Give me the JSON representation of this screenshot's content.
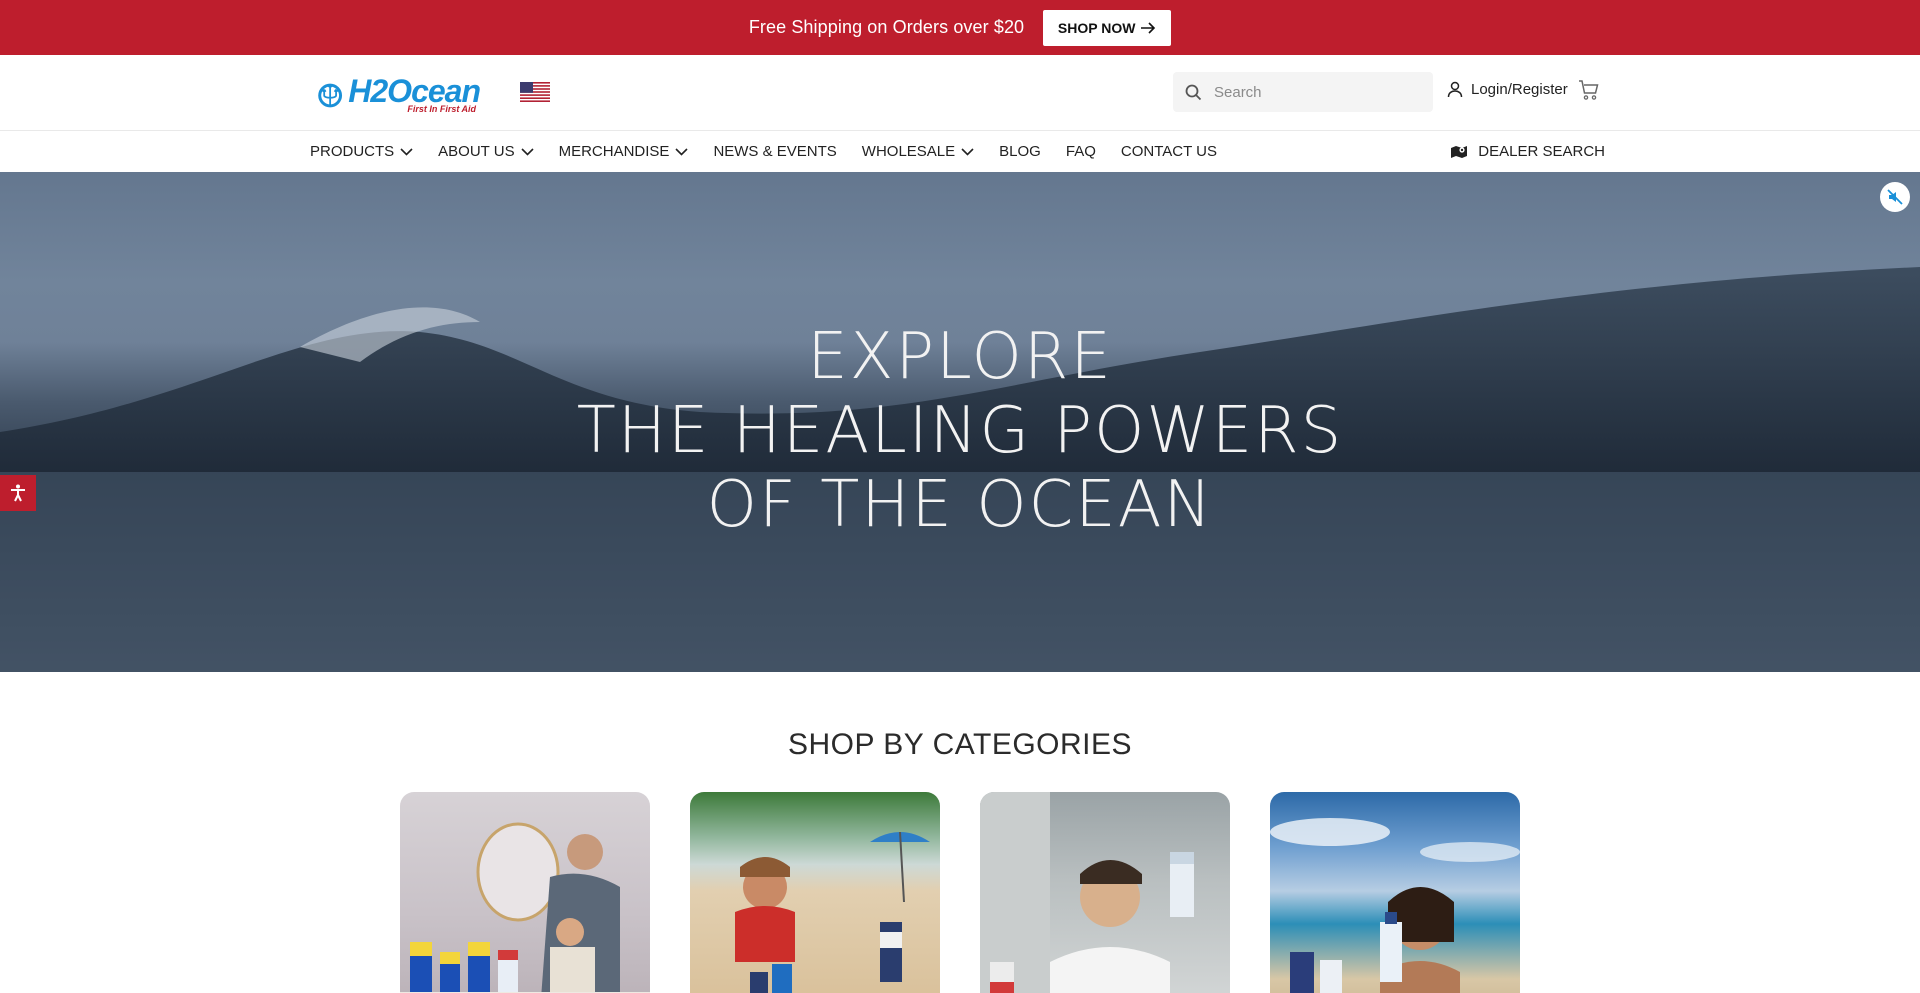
{
  "announcement": {
    "text": "Free Shipping on Orders over $20",
    "button_label": "SHOP NOW"
  },
  "header": {
    "logo_text": "H2Ocean",
    "logo_tagline": "First In First Aid",
    "search_placeholder": "Search",
    "login_label": "Login/Register"
  },
  "nav": {
    "items": [
      {
        "label": "PRODUCTS",
        "dropdown": true
      },
      {
        "label": "ABOUT US",
        "dropdown": true
      },
      {
        "label": "MERCHANDISE",
        "dropdown": true
      },
      {
        "label": "NEWS & EVENTS",
        "dropdown": false
      },
      {
        "label": "WHOLESALE",
        "dropdown": true
      },
      {
        "label": "BLOG",
        "dropdown": false
      },
      {
        "label": "FAQ",
        "dropdown": false
      },
      {
        "label": "CONTACT US",
        "dropdown": false
      }
    ],
    "dealer_label": "DEALER SEARCH"
  },
  "hero": {
    "line1": "EXPLORE",
    "line2": "THE HEALING POWERS",
    "line3": "OF THE OCEAN"
  },
  "categories": {
    "title": "SHOP BY CATEGORIES"
  },
  "colors": {
    "brand_red": "#be1e2d",
    "brand_blue": "#1a90d8"
  }
}
